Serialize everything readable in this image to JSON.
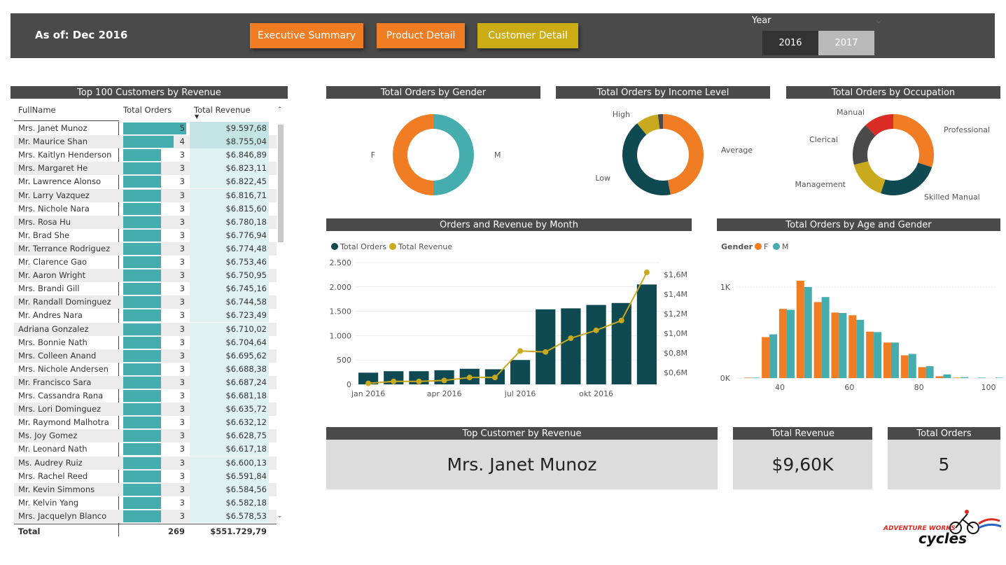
{
  "header": {
    "as_of": "As of: Dec 2016",
    "nav": [
      {
        "label": "Executive Summary",
        "color": "#f07d24"
      },
      {
        "label": "Product Detail",
        "color": "#f07d24"
      },
      {
        "label": "Customer Detail",
        "color": "#ccac14"
      }
    ],
    "year_label": "Year",
    "years": [
      {
        "label": "2016",
        "selected": true
      },
      {
        "label": "2017",
        "selected": false
      }
    ]
  },
  "colors": {
    "orange": "#f07d24",
    "teal": "#45adad",
    "dark": "#0f4a53",
    "gold": "#c9aa1e",
    "red": "#d92c24",
    "grey": "#4a4a4a"
  },
  "customers": {
    "title": "Top 100 Customers by Revenue",
    "columns": [
      "FullName",
      "Total Orders",
      "Total Revenue"
    ],
    "rows": [
      [
        "Mrs. Janet Munoz",
        "5",
        "$9.597,68"
      ],
      [
        "Mr. Maurice Shan",
        "4",
        "$8.755,04"
      ],
      [
        "Mrs. Kaitlyn Henderson",
        "3",
        "$6.846,89"
      ],
      [
        "Mrs. Margaret He",
        "3",
        "$6.823,11"
      ],
      [
        "Mr. Lawrence Alonso",
        "3",
        "$6.822,45"
      ],
      [
        "Mr. Larry Vazquez",
        "3",
        "$6.816,71"
      ],
      [
        "Mrs. Nichole Nara",
        "3",
        "$6.815,60"
      ],
      [
        "Mrs. Rosa Hu",
        "3",
        "$6.780,18"
      ],
      [
        "Mr. Brad She",
        "3",
        "$6.776,94"
      ],
      [
        "Mr. Terrance Rodriguez",
        "3",
        "$6.774,48"
      ],
      [
        "Mr. Clarence Gao",
        "3",
        "$6.753,46"
      ],
      [
        "Mr. Aaron Wright",
        "3",
        "$6.750,95"
      ],
      [
        "Mrs. Brandi Gill",
        "3",
        "$6.745,16"
      ],
      [
        "Mr. Randall Dominguez",
        "3",
        "$6.744,58"
      ],
      [
        "Mr. Andres Nara",
        "3",
        "$6.723,49"
      ],
      [
        "Adriana Gonzalez",
        "3",
        "$6.710,02"
      ],
      [
        "Mrs. Bonnie Nath",
        "3",
        "$6.704,64"
      ],
      [
        "Mrs. Colleen Anand",
        "3",
        "$6.695,62"
      ],
      [
        "Mrs. Nichole Andersen",
        "3",
        "$6.688,38"
      ],
      [
        "Mr. Francisco Sara",
        "3",
        "$6.687,24"
      ],
      [
        "Mrs. Cassandra Rana",
        "3",
        "$6.681,18"
      ],
      [
        "Mrs. Lori Dominguez",
        "3",
        "$6.635,72"
      ],
      [
        "Mr. Raymond Malhotra",
        "3",
        "$6.632,12"
      ],
      [
        "Ms. Joy Gomez",
        "3",
        "$6.628,75"
      ],
      [
        "Mr. Leonard Nath",
        "3",
        "$6.617,18"
      ],
      [
        "Ms. Audrey Ruiz",
        "3",
        "$6.600,13"
      ],
      [
        "Mrs. Rachel Reed",
        "3",
        "$6.591,84"
      ],
      [
        "Mr. Kevin Simmons",
        "3",
        "$6.584,56"
      ],
      [
        "Mr. Kelvin Yang",
        "3",
        "$6.582,18"
      ],
      [
        "Mrs. Jacquelyn Blanco",
        "3",
        "$6.578,53"
      ]
    ],
    "total_label": "Total",
    "total_orders": "269",
    "total_revenue": "$551.729,79"
  },
  "donuts": [
    {
      "title": "Total Orders by Gender",
      "slices": [
        {
          "label": "M",
          "value": 50,
          "color": "#45adad"
        },
        {
          "label": "F",
          "value": 50,
          "color": "#f07d24"
        }
      ]
    },
    {
      "title": "Total Orders by Income Level",
      "slices": [
        {
          "label": "Average",
          "value": 47,
          "color": "#f07d24"
        },
        {
          "label": "Low",
          "value": 42,
          "color": "#0f4a53"
        },
        {
          "label": "High",
          "value": 9,
          "color": "#c9aa1e"
        },
        {
          "label": "",
          "value": 2,
          "color": "#4a4a4a"
        }
      ]
    },
    {
      "title": "Total Orders by Occupation",
      "slices": [
        {
          "label": "Professional",
          "value": 30,
          "color": "#f07d24"
        },
        {
          "label": "Skilled Manual",
          "value": 25,
          "color": "#0f4a53"
        },
        {
          "label": "Management",
          "value": 16,
          "color": "#c9aa1e"
        },
        {
          "label": "Clerical",
          "value": 17,
          "color": "#4a4a4a"
        },
        {
          "label": "Manual",
          "value": 12,
          "color": "#d92c24"
        }
      ]
    }
  ],
  "chart_data": [
    {
      "type": "bar",
      "title": "Orders and Revenue by Month",
      "legend": [
        "Total Orders",
        "Total Revenue"
      ],
      "x": [
        "jan 2016",
        "feb 2016",
        "mar 2016",
        "apr 2016",
        "maj 2016",
        "jun 2016",
        "jul 2016",
        "aug 2016",
        "sep 2016",
        "okt 2016",
        "nov 2016",
        "dec 2016"
      ],
      "x_tick_labels": [
        "jan 2016",
        "apr 2016",
        "jul 2016",
        "okt 2016"
      ],
      "series": [
        {
          "name": "Total Orders",
          "axis": "left",
          "values": [
            240,
            270,
            270,
            290,
            320,
            310,
            500,
            1540,
            1560,
            1630,
            1670,
            2050
          ]
        },
        {
          "name": "Total Revenue",
          "axis": "right",
          "values": [
            0.49,
            0.51,
            0.51,
            0.52,
            0.55,
            0.55,
            0.82,
            0.81,
            0.95,
            1.03,
            1.13,
            1.62
          ]
        }
      ],
      "y_left": {
        "ticks": [
          "0",
          "500",
          "1.000",
          "1.500",
          "2.000",
          "2.500"
        ],
        "range": [
          0,
          2500
        ]
      },
      "y_right": {
        "ticks": [
          "$0,6M",
          "$0,8M",
          "$1,0M",
          "$1,2M",
          "$1,4M",
          "$1,6M"
        ],
        "range": [
          0.48,
          1.72
        ]
      }
    },
    {
      "type": "bar",
      "title": "Total Orders by Age and Gender",
      "legend_title": "Gender",
      "legend": [
        "F",
        "M"
      ],
      "ages": [
        32,
        37,
        42,
        47,
        52,
        57,
        62,
        67,
        72,
        77,
        82,
        87,
        92,
        97,
        102
      ],
      "series": [
        {
          "name": "F",
          "values": [
            5,
            450,
            760,
            1070,
            835,
            720,
            690,
            510,
            390,
            250,
            120,
            20,
            5,
            0,
            0
          ]
        },
        {
          "name": "M",
          "values": [
            5,
            480,
            750,
            1000,
            890,
            715,
            640,
            505,
            390,
            265,
            130,
            40,
            10,
            5,
            5
          ]
        }
      ],
      "y_ticks": [
        "0K",
        "1K"
      ],
      "x_ticks": [
        "40",
        "60",
        "80",
        "100"
      ],
      "ylim": [
        0,
        1200
      ]
    }
  ],
  "kpis": {
    "top_customer_title": "Top Customer by Revenue",
    "top_customer": "Mrs. Janet Munoz",
    "revenue_title": "Total Revenue",
    "revenue": "$9,60K",
    "orders_title": "Total Orders",
    "orders": "5"
  },
  "logo": {
    "line1": "ADVENTURE WORKS",
    "line2": "cycles"
  }
}
